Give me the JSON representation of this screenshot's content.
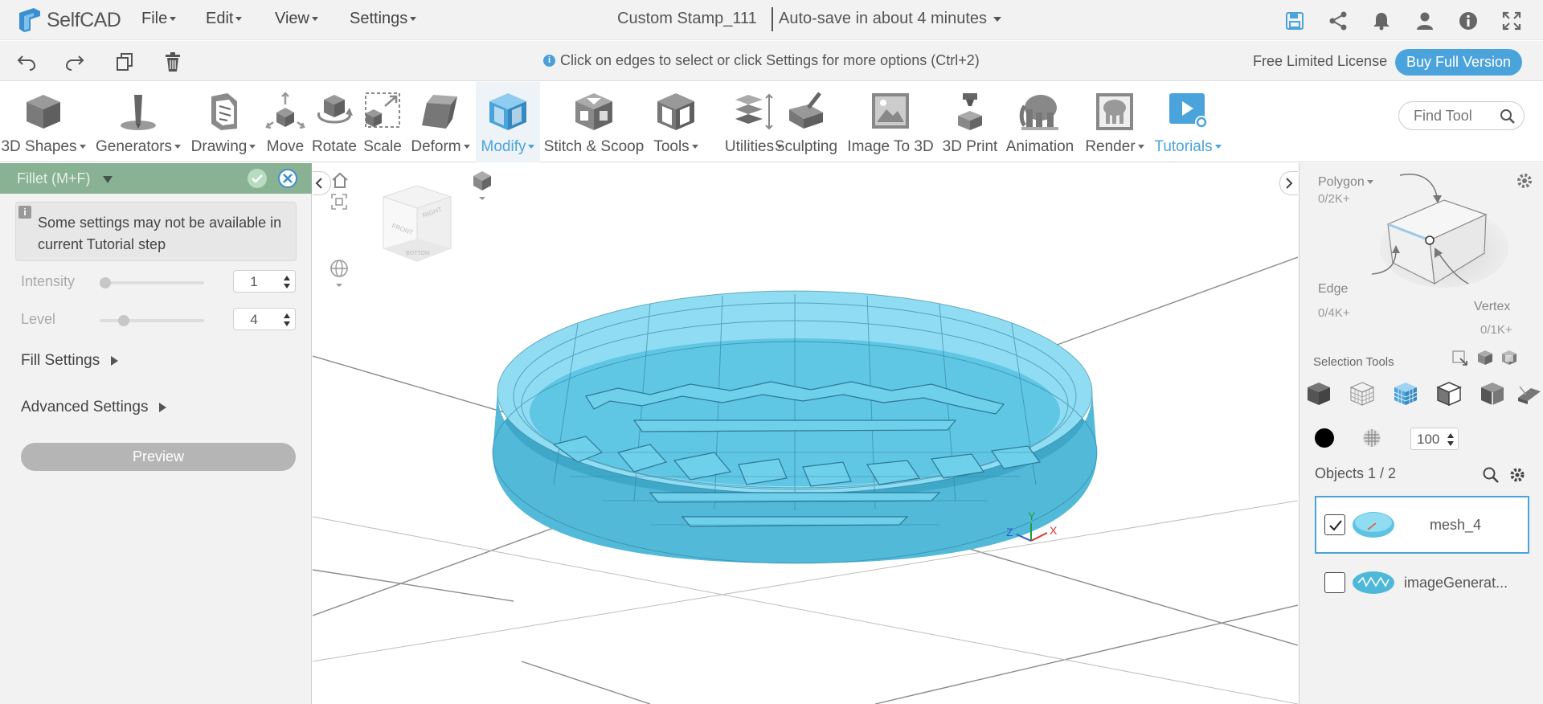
{
  "app": {
    "logo_text": "SelfCAD"
  },
  "menu": {
    "file": "File",
    "edit": "Edit",
    "view": "View",
    "settings": "Settings"
  },
  "project": {
    "name": "Custom Stamp_111",
    "autosave": "Auto-save in about 4 minutes"
  },
  "icons": {
    "top": [
      "save-icon",
      "share-icon",
      "bell-icon",
      "user-icon",
      "info-icon",
      "fullscreen-icon"
    ],
    "second_bar": [
      "undo-icon",
      "redo-icon",
      "copy-icon",
      "trash-icon"
    ]
  },
  "hint": "Click on edges to select or click Settings for more options (Ctrl+2)",
  "license": {
    "text": "Free Limited License",
    "buy": "Buy Full Version"
  },
  "colors": {
    "accent": "#4ba3db",
    "panel_header": "#89b294",
    "mesh": "#5ec3e0"
  },
  "ribbon": {
    "shapes": "3D Shapes",
    "generators": "Generators",
    "drawing": "Drawing",
    "move": "Move",
    "rotate": "Rotate",
    "scale": "Scale",
    "deform": "Deform",
    "modify": "Modify",
    "stitch": "Stitch & Scoop",
    "tools": "Tools",
    "utilities": "Utilities",
    "sculpting": "Sculpting",
    "image3d": "Image To 3D",
    "print": "3D Print",
    "animation": "Animation",
    "render": "Render",
    "tutorials": "Tutorials",
    "find_placeholder": "Find Tool"
  },
  "left_panel": {
    "title": "Fillet (M+F)",
    "notice": "Some settings may not be available in current Tutorial step",
    "intensity_label": "Intensity",
    "intensity_value": "1",
    "intensity_fraction": 0.0,
    "level_label": "Level",
    "level_value": "4",
    "level_fraction": 0.2,
    "fill_settings": "Fill Settings",
    "advanced_settings": "Advanced Settings",
    "preview": "Preview"
  },
  "viewcube": {
    "front": "FRONT",
    "right": "RIGHT",
    "bottom": "BOTTOM"
  },
  "axes": {
    "x": "X",
    "y": "Y",
    "z": "Z"
  },
  "right_panel": {
    "polygon_label": "Polygon",
    "polygon_count": "0/2K+",
    "edge_label": "Edge",
    "edge_count": "0/4K+",
    "vertex_label": "Vertex",
    "vertex_count": "0/1K+",
    "selection_tools": "Selection Tools",
    "opacity_value": "100",
    "objects_title": "Objects 1 / 2",
    "objects": [
      {
        "name": "mesh_4",
        "checked": true
      },
      {
        "name": "imageGenerat...",
        "checked": false
      }
    ]
  }
}
